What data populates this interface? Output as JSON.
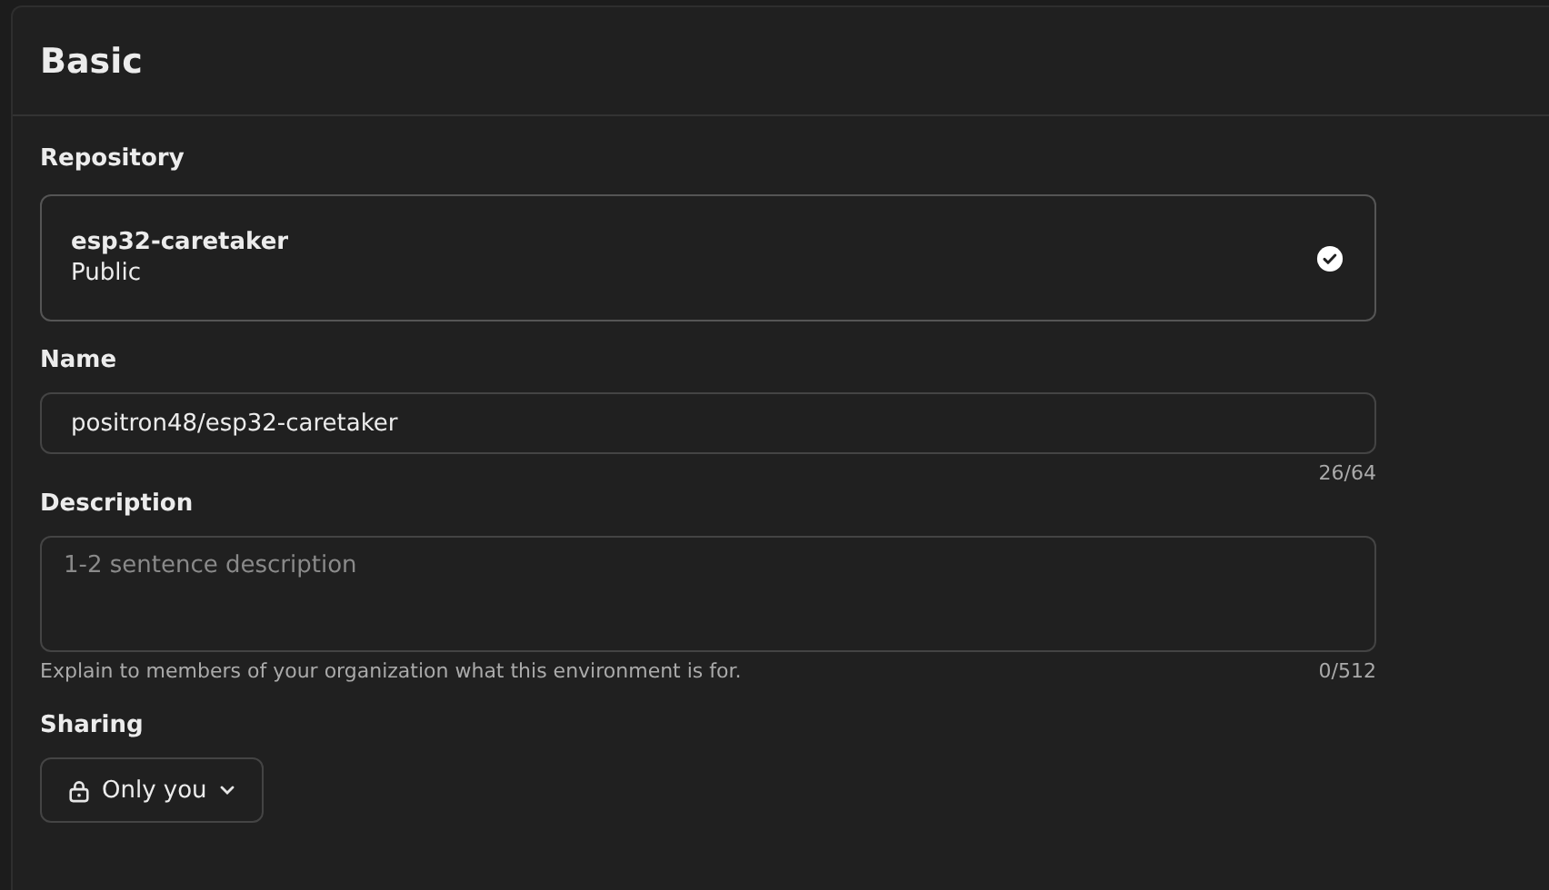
{
  "section": {
    "title": "Basic"
  },
  "repository": {
    "label": "Repository",
    "name": "esp32-caretaker",
    "visibility": "Public",
    "selected": true
  },
  "name_field": {
    "label": "Name",
    "value": "positron48/esp32-caretaker",
    "counter": "26/64"
  },
  "description_field": {
    "label": "Description",
    "placeholder": "1-2 sentence description",
    "hint": "Explain to members of your organization what this environment is for.",
    "counter": "0/512"
  },
  "sharing": {
    "label": "Sharing",
    "value": "Only you"
  }
}
